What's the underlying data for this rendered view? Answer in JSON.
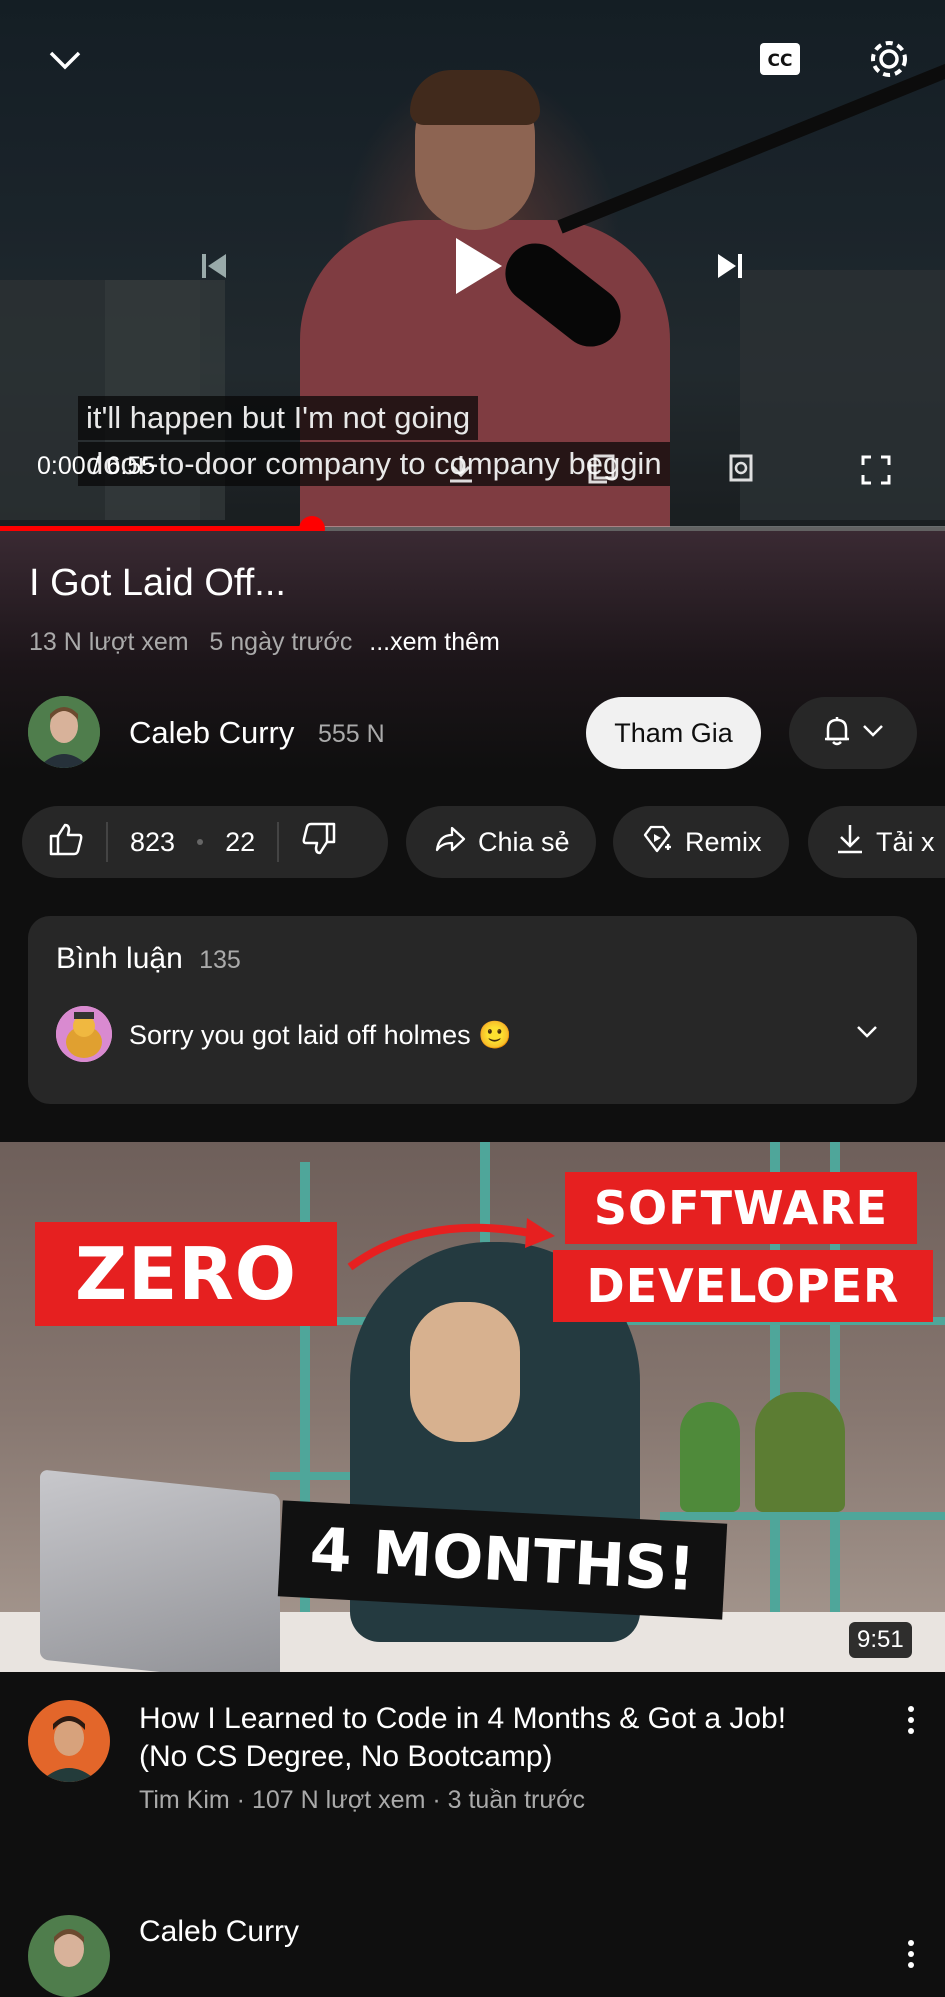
{
  "player": {
    "caption_line1": "it'll happen but I'm not going",
    "caption_line2": "door-to-door company to company beggin",
    "time": "0:00 / 6:55",
    "progress": 0.0,
    "buffered_fraction": 0.33
  },
  "video": {
    "title": "I Got Laid Off...",
    "views": "13 N lượt xem",
    "age": "5 ngày trước",
    "more": "...xem thêm"
  },
  "channel": {
    "name": "Caleb Curry",
    "subscribers": "555 N",
    "join_label": "Tham Gia"
  },
  "actions": {
    "likes": "823",
    "dislikes": "22",
    "share": "Chia sẻ",
    "remix": "Remix",
    "download": "Tải x"
  },
  "comments": {
    "label": "Bình luận",
    "count": "135",
    "top_comment": "Sorry you got laid off holmes 🙂"
  },
  "recommended": [
    {
      "thumb_text_zero": "ZERO",
      "thumb_text_software": "SOFTWARE",
      "thumb_text_developer": "DEVELOPER",
      "thumb_text_months": "4 MONTHS!",
      "duration": "9:51",
      "title": "How I Learned to Code in 4 Months & Got a Job! (No CS Degree, No Bootcamp)",
      "meta": "Tim Kim · 107 N lượt xem · 3 tuần trước"
    },
    {
      "channel": "Caleb Curry"
    }
  ],
  "icons": {
    "collapse": "chevron-down-icon",
    "cc": "cc-icon",
    "settings": "gear-icon",
    "prev": "skip-previous-icon",
    "play": "play-icon",
    "next": "skip-next-icon",
    "fullscreen": "fullscreen-icon",
    "like": "thumb-up-icon",
    "dislike": "thumb-down-icon",
    "share": "share-icon",
    "remix": "remix-icon",
    "download": "download-icon",
    "bell": "bell-icon"
  },
  "colors": {
    "accent": "#ff0000",
    "background": "#0f0f0f",
    "chip": "#272727"
  }
}
